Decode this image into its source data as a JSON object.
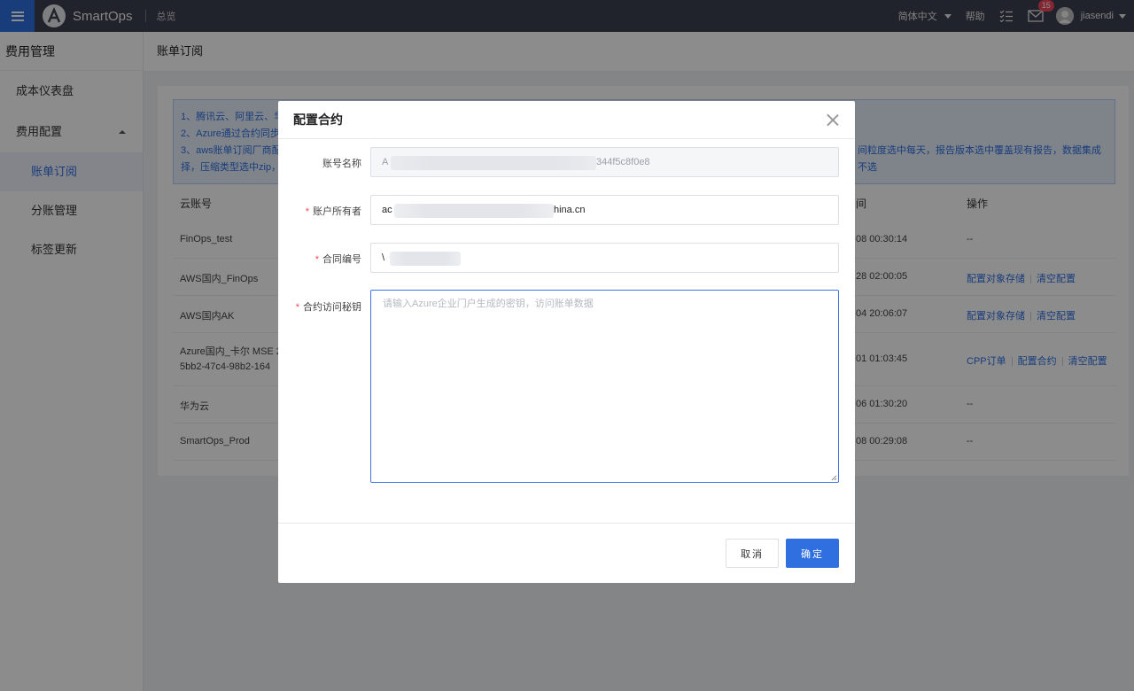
{
  "topbar": {
    "brand": "SmartOps",
    "breadcrumb": "总览",
    "language": "简体中文",
    "help": "帮助",
    "mail_count": "15",
    "username": "jiasendi"
  },
  "sidebar": {
    "title": "费用管理",
    "items": [
      {
        "label": "成本仪表盘"
      },
      {
        "label": "费用配置"
      },
      {
        "label": "账单订阅"
      },
      {
        "label": "分账管理"
      },
      {
        "label": "标签更新"
      }
    ]
  },
  "page": {
    "title": "账单订阅",
    "notice": {
      "line1": "1、腾讯云、阿里云、华",
      "line2": "2、Azure通过合约同步,",
      "line3": "3、aws账单订阅厂商配",
      "line3_right": "间粒度选中每天，报告版本选中覆盖现有报告，数据集成不选",
      "line4": "择，压缩类型选中zip，"
    },
    "table": {
      "col_account": "云账号",
      "col_time": "间",
      "col_ops": "操作",
      "rows": [
        {
          "account": "FinOps_test",
          "account2": "",
          "time": "08 00:30:14",
          "ops": [
            "--"
          ]
        },
        {
          "account": "AWS国内_FinOps",
          "account2": "",
          "time": "28 02:00:05",
          "ops": [
            "配置对象存储",
            "清空配置"
          ]
        },
        {
          "account": "AWS国内AK",
          "account2": "",
          "time": "04 20:06:07",
          "ops": [
            "配置对象存储",
            "清空配置"
          ]
        },
        {
          "account": "Azure国内_卡尔 MSE 2",
          "account2": "5bb2-47c4-98b2-164",
          "time": "01 01:03:45",
          "ops": [
            "CPP订单",
            "配置合约",
            "清空配置"
          ]
        },
        {
          "account": "华为云",
          "account2": "",
          "time": "06 01:30:20",
          "ops": [
            "--"
          ]
        },
        {
          "account": "SmartOps_Prod",
          "account2": "",
          "time": "08 00:29:08",
          "ops": [
            "--"
          ]
        }
      ]
    }
  },
  "modal": {
    "title": "配置合约",
    "fields": {
      "account_name_label": "账号名称",
      "account_name_prefix": "A",
      "account_name_suffix": "344f5c8f0e8",
      "owner_label": "账户所有者",
      "owner_prefix": "ac",
      "owner_suffix": "hina.cn",
      "contract_no_label": "合同编号",
      "contract_no_prefix": "\\",
      "secret_label": "合约访问秘钥",
      "secret_placeholder": "请输入Azure企业门户生成的密钥，访问账单数据",
      "secret_value": ""
    },
    "cancel": "取消",
    "ok": "确定"
  }
}
